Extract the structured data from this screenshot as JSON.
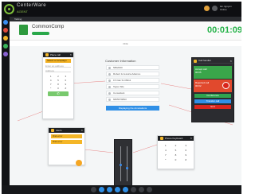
{
  "app": {
    "brand_name": "CenterWare",
    "brand_sub": "AGENT",
    "tab_label": "Talking",
    "user_line1": "lan.nguyen",
    "user_line2": "Online"
  },
  "call": {
    "caller_name": "CommonComp",
    "timer": "00:01:09",
    "subhead": "DDE"
  },
  "dial_pad": {
    "title": "Place call",
    "select_label": "Select a campaign",
    "field1": "Enter an address",
    "field2": "Address",
    "keys": [
      "1",
      "2",
      "3",
      "4",
      "5",
      "6",
      "7",
      "8",
      "9",
      "*",
      "0",
      "#"
    ]
  },
  "customer": {
    "title": "Customer Information",
    "rows": [
      "5862000",
      "Robert & Jessica Adamso",
      "15 Oak St 06911",
      "Taylor 60s",
      "Consultant",
      "6825679893"
    ],
    "button": "Displaying the Annotations"
  },
  "handler": {
    "title": "Call handler",
    "green_label": "Accept call",
    "green_sub": "00:05",
    "red_label": "Rejected call",
    "red_sub": "00:02",
    "btn_conference": "Conference",
    "btn_transfer": "Transfer call",
    "btn_end": "End"
  },
  "alerts": {
    "title": "Alerts",
    "rows": [
      "Dial error",
      "Dial error"
    ]
  },
  "phone_keyboard": {
    "title": "Phone Keyboard",
    "keys": [
      "1",
      "2",
      "3",
      "4",
      "5",
      "6",
      "7",
      "8",
      "9",
      "*",
      "0",
      "#"
    ]
  },
  "colors": {
    "accent_green": "#2aa84a",
    "accent_orange": "#f2b021",
    "accent_red": "#e1492d",
    "accent_blue": "#2f8fe6",
    "chrome_dark": "#0e0f12"
  },
  "icons": {
    "rail": [
      "phone-icon",
      "agent-icon",
      "stats-icon",
      "bell-icon",
      "users-icon"
    ],
    "toolbar": [
      "check-icon",
      "phone-icon",
      "transfer-icon",
      "hold-icon",
      "mute-icon",
      "pause-icon",
      "keypad-icon",
      "volume-icon"
    ]
  }
}
